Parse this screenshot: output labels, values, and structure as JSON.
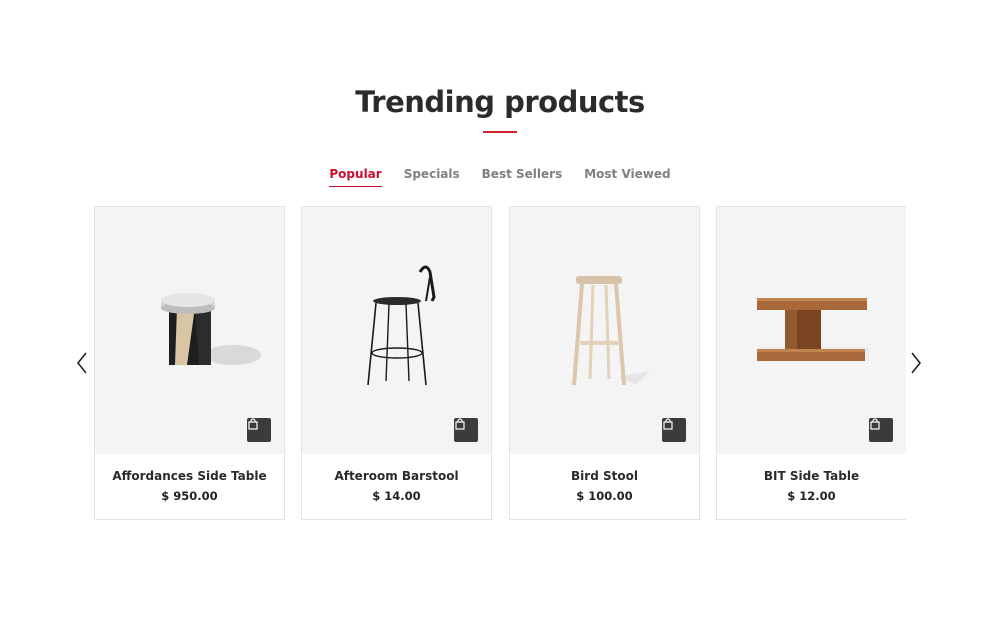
{
  "section": {
    "title": "Trending products",
    "accent_color": "#d0232b"
  },
  "tabs": [
    {
      "label": "Popular",
      "active": true
    },
    {
      "label": "Specials",
      "active": false
    },
    {
      "label": "Best Sellers",
      "active": false
    },
    {
      "label": "Most Viewed",
      "active": false
    }
  ],
  "carousel": {
    "prev_icon": "chevron-left-icon",
    "next_icon": "chevron-right-icon"
  },
  "products": [
    {
      "name": "Affordances Side Table",
      "price": "$ 950.00",
      "image": "marble-side-table",
      "cart_icon": "shopping-bag-icon"
    },
    {
      "name": "Afteroom Barstool",
      "price": "$ 14.00",
      "image": "black-metal-barstool",
      "cart_icon": "shopping-bag-icon"
    },
    {
      "name": "Bird Stool",
      "price": "$ 100.00",
      "image": "wooden-bird-stool",
      "cart_icon": "shopping-bag-icon"
    },
    {
      "name": "BIT Side Table",
      "price": "$ 12.00",
      "image": "walnut-side-table",
      "cart_icon": "shopping-bag-icon"
    }
  ]
}
